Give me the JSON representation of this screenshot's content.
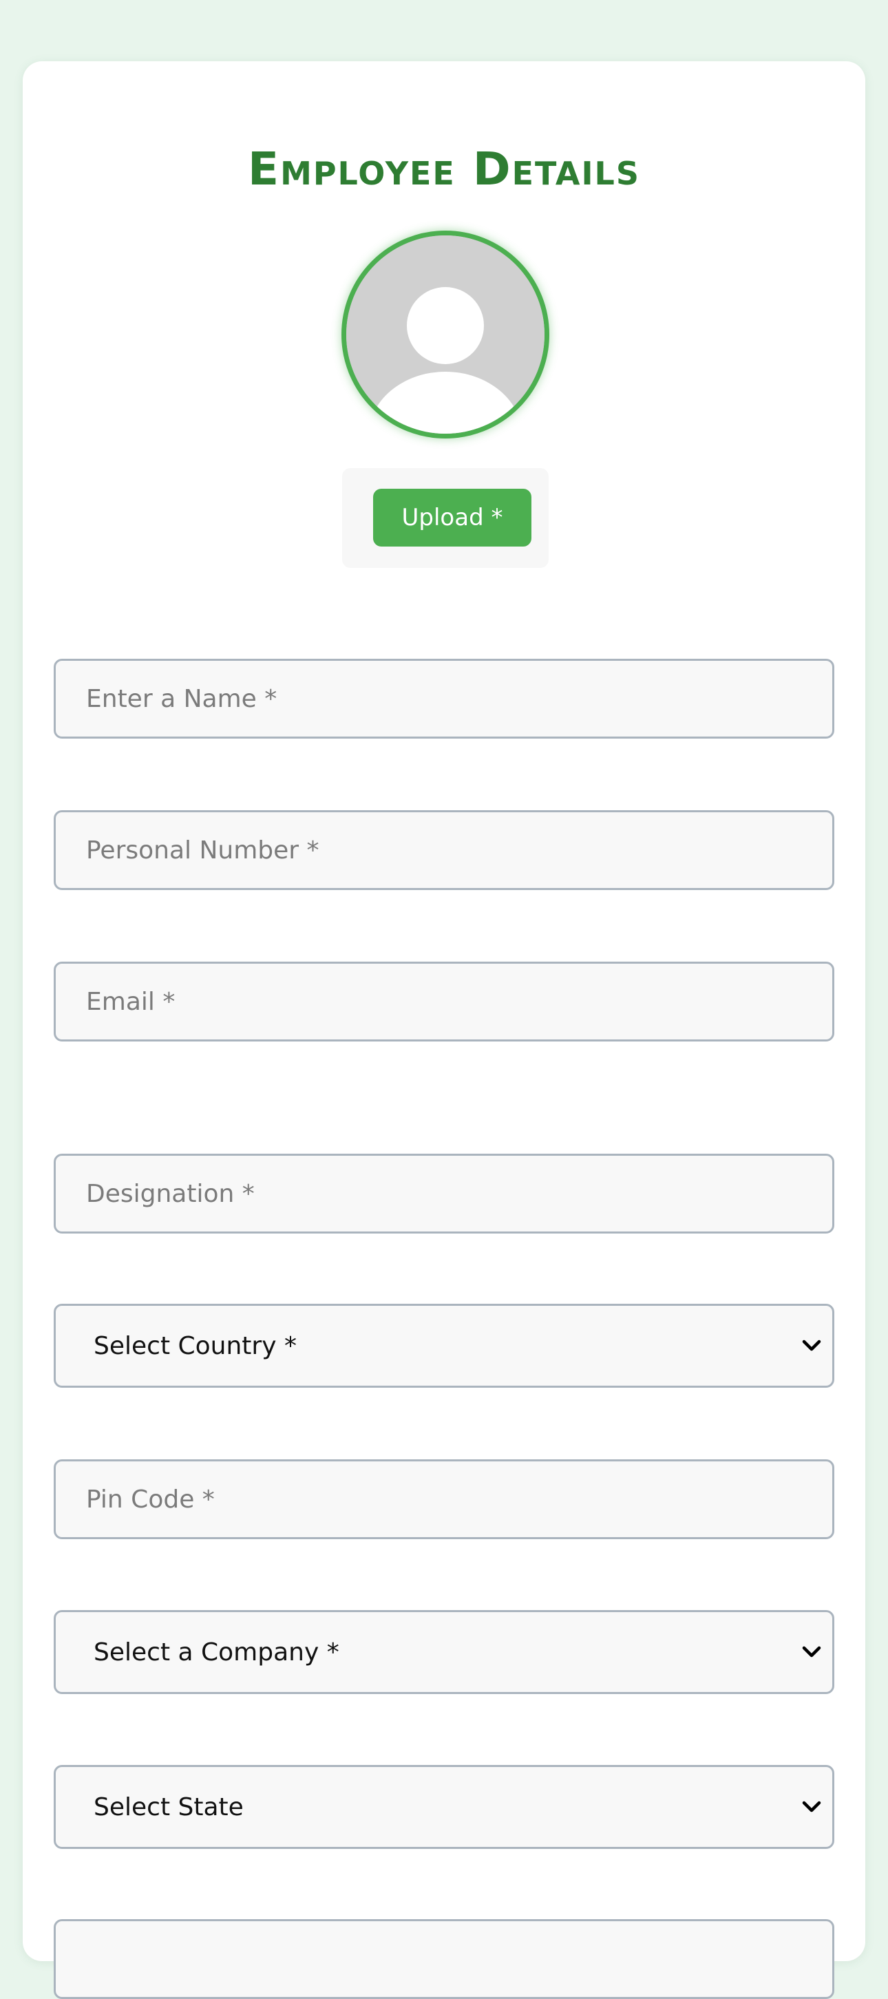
{
  "page": {
    "title": "Employee Details"
  },
  "upload": {
    "label": "Upload *"
  },
  "fields": {
    "name": {
      "placeholder": "Enter a Name *"
    },
    "personal_number": {
      "placeholder": "Personal Number *"
    },
    "email": {
      "placeholder": "Email *"
    },
    "designation": {
      "placeholder": "Designation *"
    },
    "country": {
      "selected": "Select Country *"
    },
    "pin_code": {
      "placeholder": "Pin Code *"
    },
    "company": {
      "selected": "Select a Company *"
    },
    "state": {
      "selected": "Select State"
    }
  },
  "icons": {
    "avatar": "user-silhouette-icon",
    "dropdown": "chevron-down-icon"
  },
  "colors": {
    "accent": "#4caf50",
    "title": "#2e7d32",
    "background": "#e8f5ec",
    "field_border": "#aab4be",
    "field_background": "#f8f8f8"
  }
}
